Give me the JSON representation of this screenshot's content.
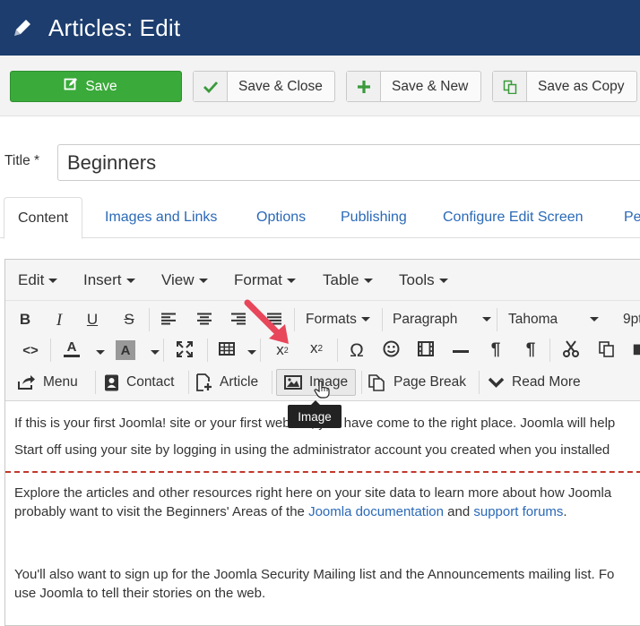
{
  "header": {
    "title": "Articles: Edit",
    "icon": "pencil-icon"
  },
  "toolbar": {
    "save": "Save",
    "save_close": "Save & Close",
    "save_new": "Save & New",
    "save_copy": "Save as Copy"
  },
  "title_field": {
    "label": "Title *",
    "value": "Beginners"
  },
  "tabs": [
    "Content",
    "Images and Links",
    "Options",
    "Publishing",
    "Configure Edit Screen",
    "Pe"
  ],
  "editor": {
    "menus": [
      "Edit",
      "Insert",
      "View",
      "Format",
      "Table",
      "Tools"
    ],
    "formats_dropdown": "Formats",
    "block_dropdown": "Paragraph",
    "font_dropdown": "Tahoma",
    "size_dropdown": "9pt",
    "extra_buttons": [
      "Menu",
      "Contact",
      "Article",
      "Image",
      "Page Break",
      "Read More"
    ],
    "tooltip": "Image"
  },
  "content": {
    "p1": "If this is your first Joomla! site or your first website, you have come to the right place. Joomla will help",
    "p2": "Start off using your site by logging in using the administrator account you created when you installed",
    "p3_line1": "Explore the articles and other resources right here on your site data to learn more about how Joomla",
    "p3_line2_start": "probably want to visit the Beginners' Areas of the ",
    "p3_link1": "Joomla documentation",
    "p3_mid": " and ",
    "p3_link2": "support forums",
    "p3_end": ".",
    "p4_line1": "You'll also want to sign up for the Joomla Security Mailing list and the Announcements mailing list. Fo",
    "p4_line2": "use Joomla to tell their stories on the web."
  },
  "colors": {
    "header_bg": "#1c3d6e",
    "save_green": "#3aaa3a",
    "link_blue": "#2a69b8",
    "arrow_red": "#e8465a"
  }
}
